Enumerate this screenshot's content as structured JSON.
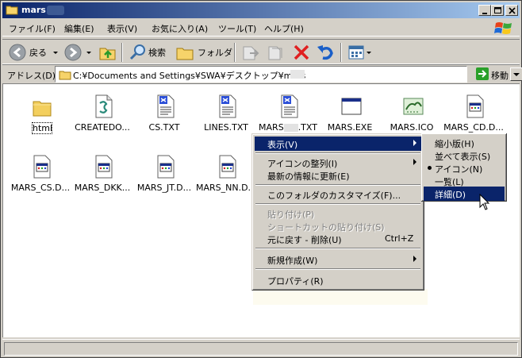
{
  "window": {
    "title": "mars"
  },
  "menubar": {
    "items": [
      "ファイル(F)",
      "編集(E)",
      "表示(V)",
      "お気に入り(A)",
      "ツール(T)",
      "ヘルプ(H)"
    ]
  },
  "toolbar": {
    "back_label": "戻る",
    "search_label": "検索",
    "folders_label": "フォルダ"
  },
  "address": {
    "label": "アドレス(D)",
    "value": "C:¥Documents and Settings¥SWA¥デスクトップ¥mars",
    "go_label": "移動"
  },
  "files": [
    {
      "name": "html",
      "icon": "folder-icon"
    },
    {
      "name": "CREATEDO...",
      "icon": "script-file-icon"
    },
    {
      "name": "CS.TXT",
      "icon": "text-file-icon"
    },
    {
      "name": "LINES.TXT",
      "icon": "text-file-icon"
    },
    {
      "name": "MARS",
      "suffix": ".TXT",
      "icon": "text-file-icon"
    },
    {
      "name": "MARS.EXE",
      "icon": "exe-file-icon"
    },
    {
      "name": "MARS.ICO",
      "icon": "ico-file-icon"
    },
    {
      "name": "MARS_CD.D...",
      "icon": "data-file-icon"
    },
    {
      "name": "MARS_CS.D...",
      "icon": "data-file-icon"
    },
    {
      "name": "MARS_DKK...",
      "icon": "data-file-icon"
    },
    {
      "name": "MARS_JT.D...",
      "icon": "data-file-icon"
    },
    {
      "name": "MARS_NN.D...",
      "icon": "data-file-icon"
    }
  ],
  "context_menu": {
    "view": "表示(V)",
    "arrange": "アイコンの整列(I)",
    "refresh": "最新の情報に更新(E)",
    "customize": "このフォルダのカスタマイズ(F)...",
    "paste": "貼り付け(P)",
    "paste_shortcut": "ショートカットの貼り付け(S)",
    "undo": "元に戻す - 削除(U)",
    "undo_shortcut": "Ctrl+Z",
    "new": "新規作成(W)",
    "properties": "プロパティ(R)"
  },
  "view_submenu": {
    "thumbnails": "縮小版(H)",
    "tiles": "並べて表示(S)",
    "icons": "アイコン(N)",
    "list": "一覧(L)",
    "details": "詳細(D)"
  },
  "colors": {
    "highlight": "#0a246a",
    "face": "#d4d0c8"
  }
}
